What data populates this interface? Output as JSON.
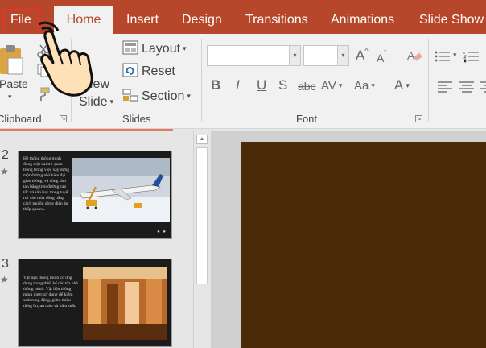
{
  "tabs": {
    "file": "File",
    "home": "Home",
    "insert": "Insert",
    "design": "Design",
    "transitions": "Transitions",
    "animations": "Animations",
    "slide_show": "Slide Show"
  },
  "ribbon": {
    "clipboard": {
      "label": "Clipboard",
      "paste": "Paste"
    },
    "slides": {
      "label": "Slides",
      "new_slide_line1": "New",
      "new_slide_line2": "Slide",
      "layout": "Layout",
      "reset": "Reset",
      "section": "Section"
    },
    "font": {
      "label": "Font",
      "font_name": "",
      "font_size": "",
      "bold": "B",
      "italic": "I",
      "underline": "U",
      "shadow": "S",
      "strike": "abc",
      "spacing": "AV",
      "case": "Aa",
      "color": "A"
    }
  },
  "slides": [
    {
      "number": "2",
      "text": "Hệ thống thông minh đóng một vai trò quan trọng trong việc xây dựng một đường nhà hiện đại giao thông, và cũng làm tan băng trên đường cao tốc và sân bay trong tuyết rơi vào mùa đông bằng cách truyền dòng điện áp thấp qua nó."
    },
    {
      "number": "3",
      "text": "Vật liệu thông minh có ứng dụng trong thiết kế các tòa nhà thông minh. Vật liệu thông minh được sử dụng để kiểm soát rung động, giảm thiểu tiếng ồn, an toàn và hiệu suất."
    }
  ],
  "colors": {
    "accent": "#b7472a",
    "ribbon_bg": "#f1f1f1",
    "slide_bg": "#4a2a08",
    "file_highlight": "#ff2a2a"
  },
  "icons": {
    "cursor": "hand-pointer-icon",
    "paste": "clipboard-paste-icon",
    "layout": "layout-icon",
    "reset": "reset-icon",
    "section": "section-icon"
  }
}
